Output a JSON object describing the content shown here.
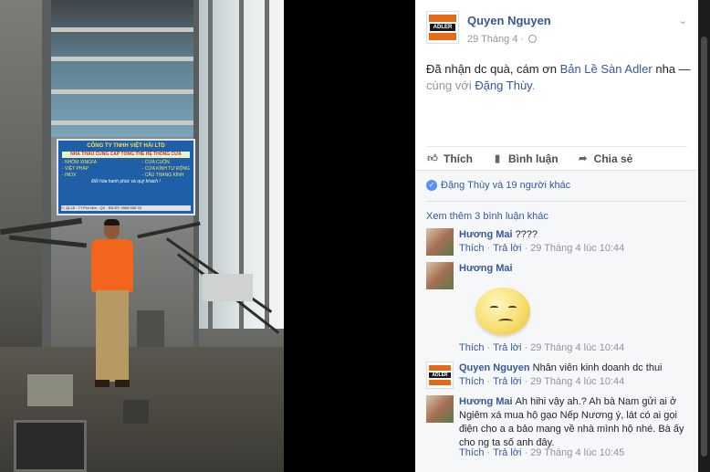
{
  "post": {
    "author": "Quyen Nguyen",
    "date": "29 Tháng 4 ·",
    "logo_text": "ADLER",
    "text_before": "Đã nhận dc quà, cám ơn ",
    "text_link": "Bản Lề Sàn Adler",
    "text_after": " nha —",
    "with_prefix": "cùng với ",
    "with_link": "Đặng Thùy",
    "with_suffix": "."
  },
  "actions": {
    "like": "Thích",
    "comment": "Bình luận",
    "share": "Chia sẻ"
  },
  "reactions": {
    "summary": "Đặng Thùy và 19 người khác"
  },
  "comments_section": {
    "more": "Xem thêm 3 bình luận khác",
    "items": [
      {
        "name": "Hương Mai",
        "text": "????",
        "like": "Thích",
        "reply": "Trả lời",
        "time": "29 Tháng 4 lúc 10:44"
      },
      {
        "name": "Hương Mai",
        "text": "",
        "like": "Thích",
        "reply": "Trả lời",
        "time": "29 Tháng 4 lúc 10:44"
      },
      {
        "name": "Quyen Nguyen",
        "text": "Nhân viên kinh doanh dc thui",
        "like": "Thích",
        "reply": "Trả lời",
        "time": "29 Tháng 4 lúc 10:44"
      },
      {
        "name": "Hương Mai",
        "text": "Ah hihi vậy ah.? Ah bà Nam gửi ai ở Ngiêm xá mua hộ gạo Nếp Nương ý, lát có ai gọi điện cho a a bảo mang về nhà mình hộ nhé. Bà ấy cho ng ta số anh đây.",
        "like": "Thích",
        "reply": "Trả lời",
        "time": "29 Tháng 4 lúc 10:45"
      }
    ]
  },
  "photo_sign": {
    "company": "CÔNG TY TNHH VIỆT HẢI LTD",
    "strip": "NHÀ THẦU CUNG CẤP TỔNG THỂ HỆ THỐNG CỬA",
    "col1": [
      "- NHÔM XINGFA",
      "- VIỆT PHÁP",
      "- INOX"
    ],
    "col2": [
      "- CỬA CUỐN",
      "- CỬA KÍNH TỰ ĐỘNG",
      "- CẦU THANG KÍNH"
    ],
    "slogan": "Đổi hòa hạnh phúc và quý khách !",
    "footer": "C: QL18 - TT.Phố Mới - QV - BN       ĐT: 0966 556 33"
  },
  "colors": {
    "link": "#365899",
    "meta": "#90949c",
    "text": "#1d2129",
    "brand_orange": "#e36b1a"
  }
}
